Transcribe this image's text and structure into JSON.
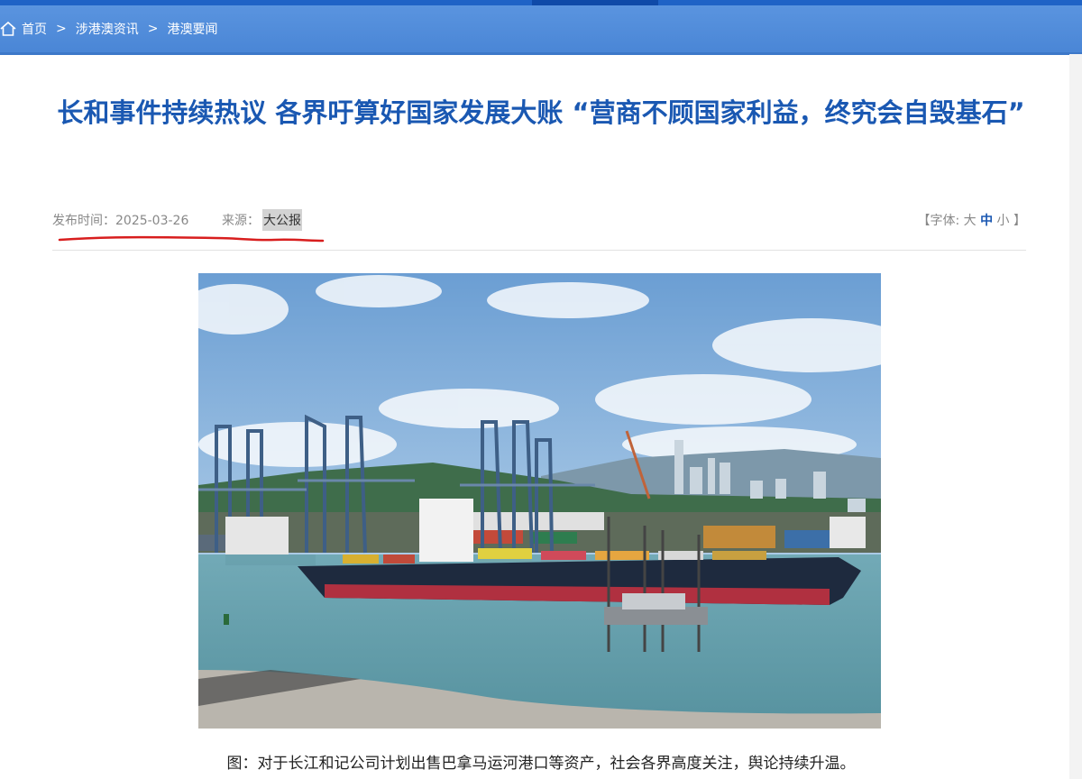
{
  "breadcrumb": {
    "items": [
      "首页",
      "涉港澳资讯",
      "港澳要闻"
    ],
    "separator": ">"
  },
  "article": {
    "title": "长和事件持续热议 各界吁算好国家发展大账 “营商不顾国家利益，终究会自毁基石”",
    "date_label": "发布时间：2025-03-26",
    "source_label": "来源：",
    "source_value": "大公报",
    "font_size_prefix": "【字体:",
    "font_large": "大",
    "font_medium": "中",
    "font_small": "小",
    "font_size_suffix": "】",
    "caption": "图：对于长江和记公司计划出售巴拿马运河港口等资产，社会各界高度关注，舆论持续升温。"
  },
  "colors": {
    "title": "#1a58b2",
    "header_bar": "#4a86d6",
    "annotation": "#d81e1e"
  },
  "icons": [
    "home-icon"
  ]
}
